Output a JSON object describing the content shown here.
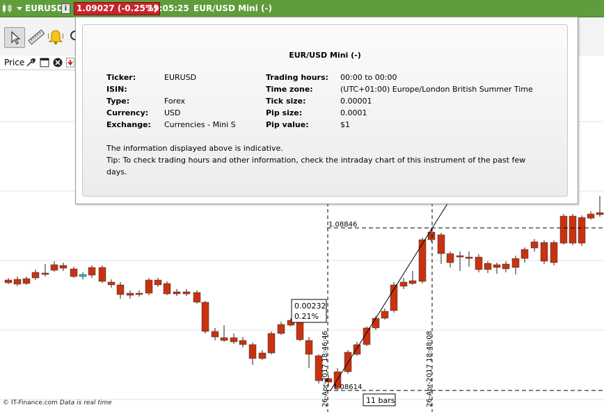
{
  "topbar": {
    "ticker": "EURUSD",
    "price_change": "1.09027 (-0.25%)",
    "time": "19:05:25",
    "instrument": "EUR/USD Mini (-)"
  },
  "panel": {
    "label": "Price"
  },
  "popup": {
    "title": "EUR/USD Mini (-)",
    "left": [
      {
        "label": "Ticker:",
        "value": "EURUSD"
      },
      {
        "label": "ISIN:",
        "value": ""
      },
      {
        "label": "Type:",
        "value": "Forex"
      },
      {
        "label": "Currency:",
        "value": "USD"
      },
      {
        "label": "Exchange:",
        "value": "Currencies - Mini S"
      }
    ],
    "right": [
      {
        "label": "Trading hours:",
        "value": "00:00 to 00:00"
      },
      {
        "label": "Time zone:",
        "value": "(UTC+01:00) Europe/London British Summer Time"
      },
      {
        "label": "Tick size:",
        "value": "0.00001"
      },
      {
        "label": "Pip size:",
        "value": "0.0001"
      },
      {
        "label": "Pip value:",
        "value": "$1"
      }
    ],
    "note": "The information displayed above is indicative.",
    "tip_line1": "Tip: To check trading hours and other information, check the intraday chart of this instrument of the past few",
    "tip_line2": "days."
  },
  "annotations": {
    "level_high": "1.08846",
    "level_low": "1.08614",
    "measure_abs": "0.00232",
    "measure_pct": "0.21%",
    "date_left": "26-Apr-2017 18:46:46",
    "date_right": "26-Apr-2017 18:48:08",
    "bars_count": "11 bars"
  },
  "footer": {
    "brand": "© IT-Finance.com",
    "note": "Data is real time"
  },
  "colors": {
    "topbar": "#5f9d3c",
    "price_badge": "#c8252c",
    "bull_candle": "#1fc3c6",
    "bear_candle": "#c8320f"
  },
  "icons": [
    "candlestick-icon",
    "chevron-down-icon",
    "info-icon",
    "pointer-icon",
    "ruler-icon",
    "bell-icon",
    "wrench-icon",
    "window-icon",
    "close-icon",
    "download-icon"
  ]
}
